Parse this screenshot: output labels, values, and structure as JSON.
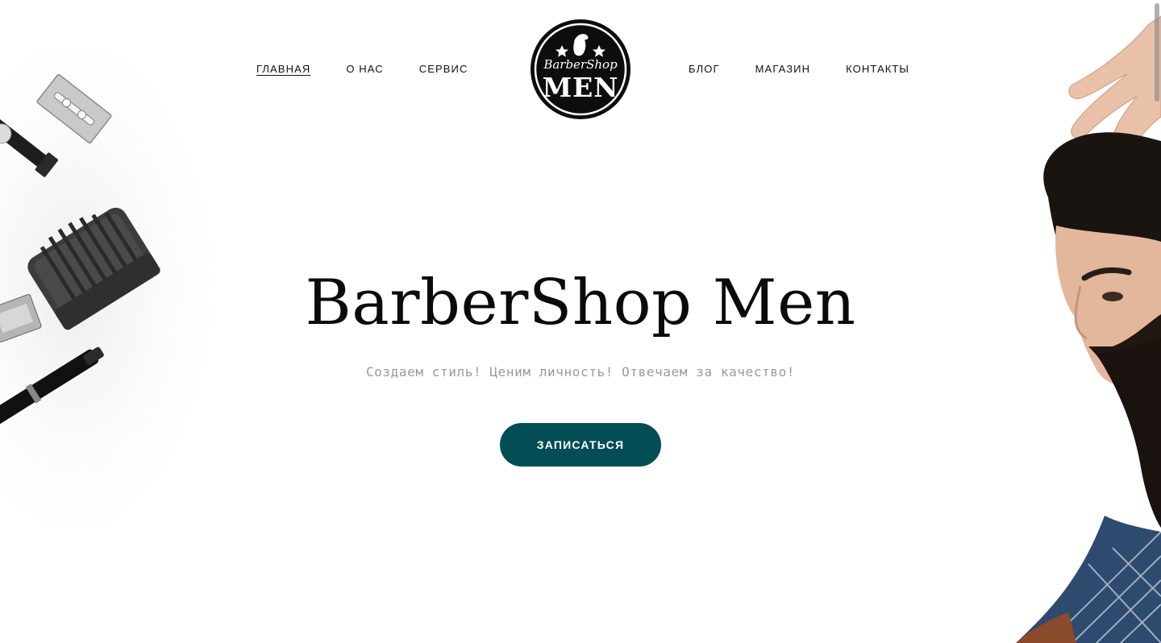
{
  "nav": {
    "left": [
      {
        "label": "ГЛАВНАЯ",
        "active": true
      },
      {
        "label": "О НАС"
      },
      {
        "label": "СЕРВИС"
      }
    ],
    "right": [
      {
        "label": "БЛОГ"
      },
      {
        "label": "МАГАЗИН"
      },
      {
        "label": "КОНТАКТЫ"
      }
    ]
  },
  "logo": {
    "script_text": "BarberShop",
    "main_text": "MEN"
  },
  "hero": {
    "title": "BarberShop Men",
    "subtitle": "Создаем стиль! Ценим личность! Отвечаем за качество!",
    "cta_label": "ЗАПИСАТЬСЯ"
  },
  "colors": {
    "accent": "#034d55",
    "text": "#0b0b0b",
    "muted": "#9a9a9a",
    "background": "#ffffff"
  },
  "icons": {
    "logo": "barbershop-emblem",
    "tools_image": "barber-tools-photo",
    "man_image": "bearded-man-photo"
  }
}
